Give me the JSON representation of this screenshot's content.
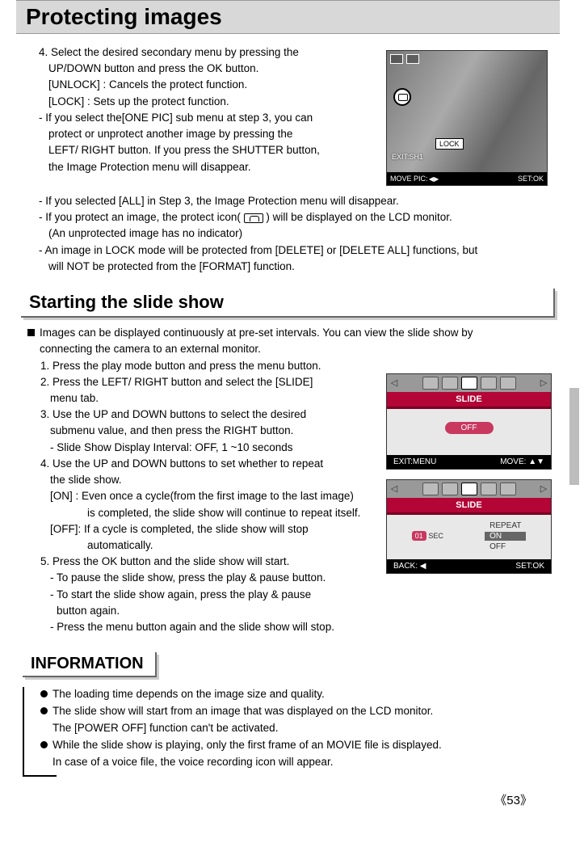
{
  "header": {
    "title": "Protecting images"
  },
  "protect": {
    "step4": "4. Select the desired secondary menu by pressing the",
    "step4b": "UP/DOWN button and press the OK button.",
    "unlock": "[UNLOCK]   : Cancels the protect function.",
    "lock": "[LOCK]        : Sets up the protect function.",
    "note1a": "- If you select the[ONE PIC] sub menu at step 3, you can",
    "note1b": "protect or unprotect another image by pressing the",
    "note1c": "LEFT/ RIGHT button. If you press the SHUTTER button,",
    "note1d": "the Image Protection menu will disappear.",
    "note2": "- If you selected [ALL] in Step 3, the Image Protection menu will disappear.",
    "note3a": "- If you protect an image, the protect icon(",
    "note3b": ") will be displayed on the LCD monitor.",
    "note3c": "(An unprotected image has no indicator)",
    "note4a": "- An image in LOCK mode will be protected from [DELETE] or [DELETE ALL] functions, but",
    "note4b": "will NOT be protected from the [FORMAT] function."
  },
  "lcd1": {
    "lock_label": "LOCK",
    "exit_label": "EXIT:SH1",
    "move_label": "MOVE PIC:",
    "set_label": "SET:OK"
  },
  "slide_heading": "Starting the slide show",
  "slide": {
    "intro1": "Images can be displayed continuously at pre-set intervals. You can view the slide show by",
    "intro2": "connecting the camera to an external monitor.",
    "s1": "1. Press the play mode button and press the menu button.",
    "s2a": "2. Press the LEFT/ RIGHT button and select the [SLIDE]",
    "s2b": "menu tab.",
    "s3a": "3. Use the UP and DOWN buttons to select the desired",
    "s3b": "submenu value, and then press the RIGHT button.",
    "s3c": "- Slide Show Display Interval: OFF, 1 ~10 seconds",
    "s4a": "4. Use the UP and DOWN buttons to set whether to repeat",
    "s4b": "the slide show.",
    "s4on_a": "[ON]  : Even once a cycle(from the first image to the last image)",
    "s4on_b": "is completed, the slide show will continue to repeat itself.",
    "s4off_a": "[OFF]: If a cycle is completed, the slide show will stop",
    "s4off_b": "automatically.",
    "s5": "5. Press the OK button and the slide show will start.",
    "s5a": "- To pause the slide show, press the play & pause button.",
    "s5b": "- To start the slide show again, press the play & pause",
    "s5c": "button again.",
    "s5d": "- Press the menu button again and the slide show will stop."
  },
  "lcd2": {
    "title": "SLIDE",
    "off": "OFF",
    "exit": "EXIT:MENU",
    "move": "MOVE:"
  },
  "lcd3": {
    "title": "SLIDE",
    "sec_val": "01",
    "sec_unit": "SEC",
    "repeat": "REPEAT",
    "on": "ON",
    "off": "OFF",
    "back": "BACK:",
    "set": "SET:OK"
  },
  "info_heading": "INFORMATION",
  "info": {
    "i1": "The loading time depends on the image size and quality.",
    "i2a": "The slide show will start from an image that was displayed on the LCD monitor.",
    "i2b": "The [POWER OFF] function can't be activated.",
    "i3a": "While the slide show is playing, only the first frame of an MOVIE file is displayed.",
    "i3b": "In case of a voice file, the voice recording icon will appear."
  },
  "page": "53"
}
